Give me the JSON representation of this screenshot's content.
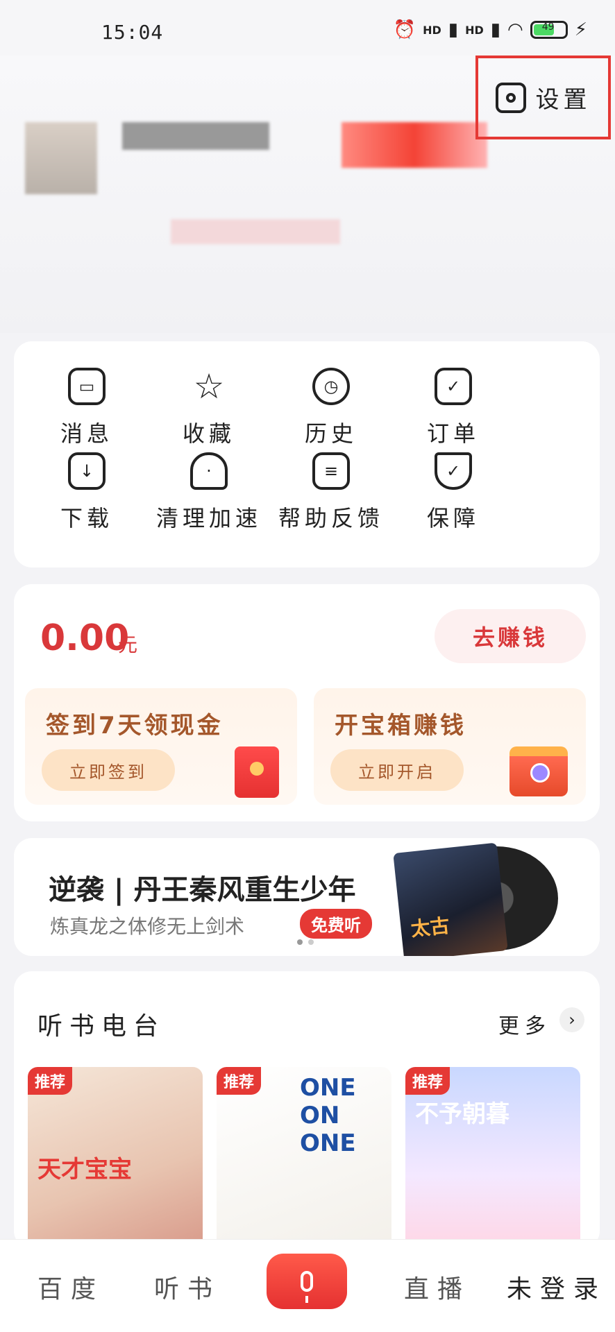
{
  "status": {
    "time": "15:04",
    "signal_1": "HD",
    "signal_2": "HD",
    "battery": "49"
  },
  "settings": {
    "label": "设置"
  },
  "grid": [
    {
      "label": "消息",
      "icon": "message-icon"
    },
    {
      "label": "收藏",
      "icon": "star-icon"
    },
    {
      "label": "历史",
      "icon": "clock-icon"
    },
    {
      "label": "订单",
      "icon": "calendar-check-icon"
    },
    {
      "label": "下载",
      "icon": "download-icon"
    },
    {
      "label": "清理加速",
      "icon": "rocket-icon"
    },
    {
      "label": "帮助反馈",
      "icon": "feedback-icon"
    },
    {
      "label": "保障",
      "icon": "shield-check-icon"
    }
  ],
  "earn": {
    "amount": "0.00",
    "unit": "元",
    "button": "去赚钱",
    "task1": {
      "title": "签到7天领现金",
      "button": "立即签到"
    },
    "task2": {
      "title": "开宝箱赚钱",
      "button": "立即开启"
    }
  },
  "banner": {
    "title": "逆袭 | 丹王秦风重生少年",
    "subtitle": "炼真龙之体修无上剑术",
    "badge": "免费听"
  },
  "radio": {
    "title": "听书电台",
    "more": "更多",
    "books": [
      {
        "tag": "推荐"
      },
      {
        "tag": "推荐"
      },
      {
        "tag": "推荐"
      }
    ]
  },
  "tabs": {
    "baidu": "百度",
    "books": "听书",
    "live": "直播",
    "login": "未登录"
  },
  "colors": {
    "accent": "#e53935",
    "gold": "#a4572b",
    "highlight_box": "#e53935"
  }
}
